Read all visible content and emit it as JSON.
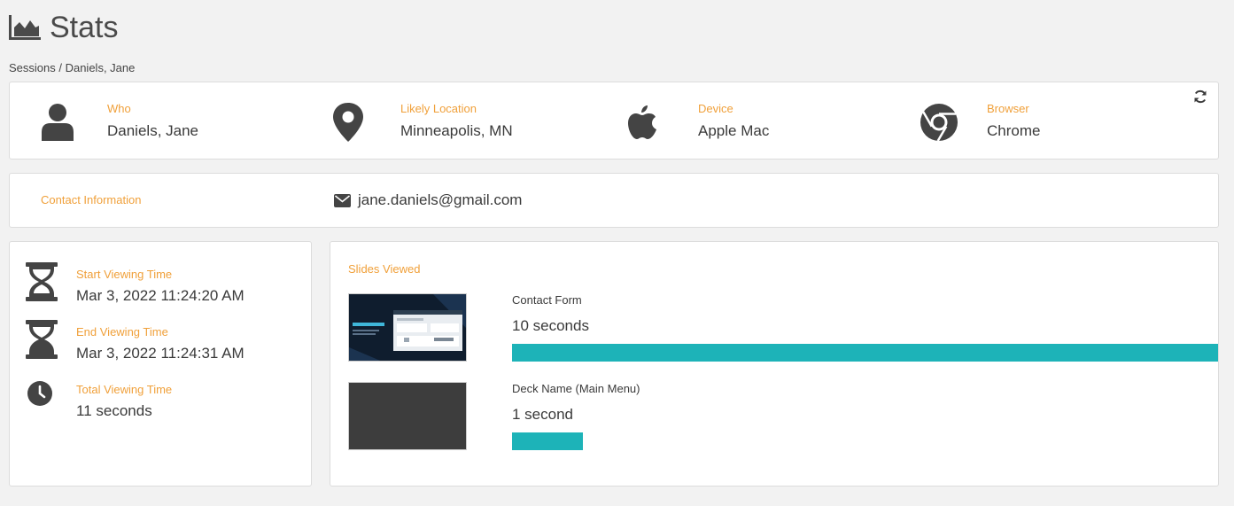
{
  "header": {
    "title": "Stats",
    "icon": "area-chart-icon"
  },
  "breadcrumb": "Sessions / Daniels, Jane",
  "colors": {
    "label": "#f0a03a",
    "bar": "#1db3b8",
    "icon": "#444444"
  },
  "info": [
    {
      "label": "Who",
      "value": "Daniels, Jane",
      "icon": "user-icon"
    },
    {
      "label": "Likely Location",
      "value": "Minneapolis, MN",
      "icon": "map-marker-icon"
    },
    {
      "label": "Device",
      "value": "Apple Mac",
      "icon": "apple-icon"
    },
    {
      "label": "Browser",
      "value": "Chrome",
      "icon": "chrome-icon"
    }
  ],
  "contact": {
    "label": "Contact Information",
    "email": "jane.daniels@gmail.com"
  },
  "times": [
    {
      "label": "Start Viewing Time",
      "value": "Mar 3, 2022 11:24:20 AM",
      "icon": "hourglass-start-icon"
    },
    {
      "label": "End Viewing Time",
      "value": "Mar 3, 2022 11:24:31 AM",
      "icon": "hourglass-end-icon"
    },
    {
      "label": "Total Viewing Time",
      "value": "11 seconds",
      "icon": "clock-icon"
    }
  ],
  "slides": {
    "label": "Slides Viewed",
    "items": [
      {
        "name": "Contact Form",
        "duration": "10 seconds",
        "fraction": 1.0
      },
      {
        "name": "Deck Name (Main Menu)",
        "duration": "1 second",
        "fraction": 0.1
      }
    ]
  }
}
